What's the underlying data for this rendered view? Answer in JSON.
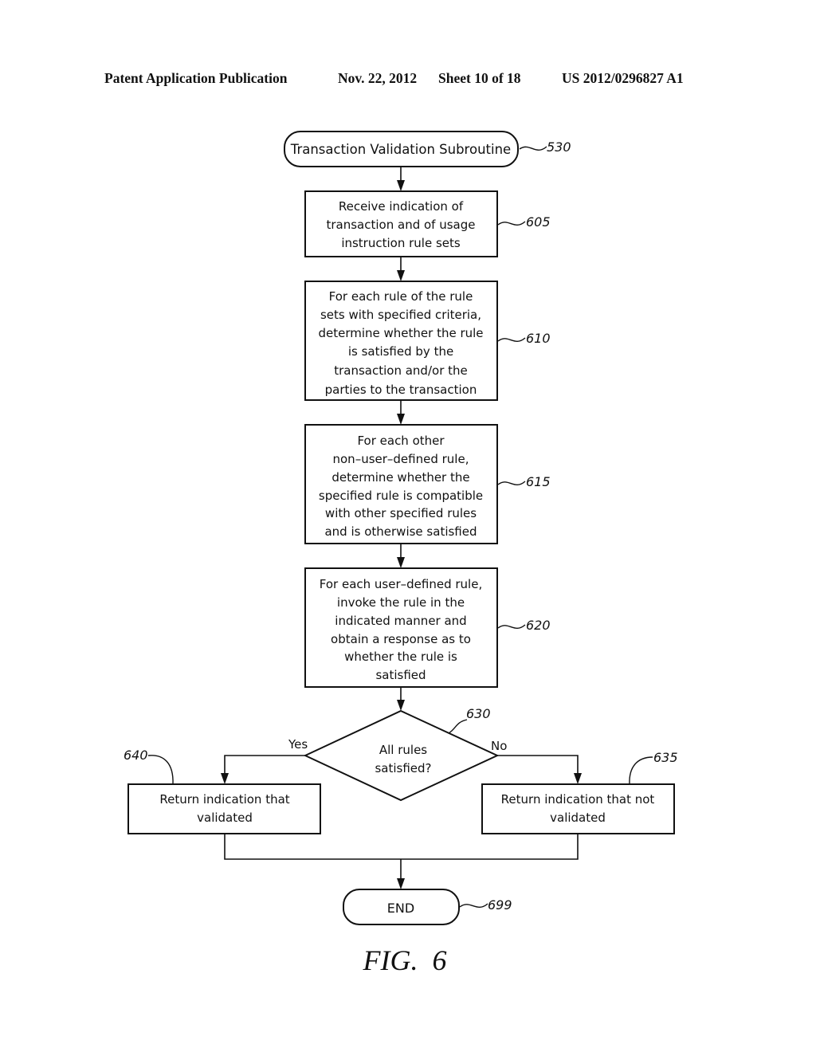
{
  "header": {
    "publication": "Patent Application Publication",
    "date": "Nov. 22, 2012",
    "sheet": "Sheet 10 of 18",
    "number": "US 2012/0296827 A1"
  },
  "diagram": {
    "start": {
      "label": "Transaction Validation Subroutine",
      "ref": "530"
    },
    "steps": [
      {
        "ref": "605",
        "lines": [
          "Receive indication of",
          "transaction and of usage",
          "instruction rule sets"
        ]
      },
      {
        "ref": "610",
        "lines": [
          "For each rule of the rule",
          "sets with specified criteria,",
          "determine whether the rule",
          "is satisfied by the",
          "transaction and/or the",
          "parties to the transaction"
        ]
      },
      {
        "ref": "615",
        "lines": [
          "For each other",
          "non–user–defined rule,",
          "determine whether the",
          "specified rule is compatible",
          "with other specified rules",
          "and is otherwise satisfied"
        ]
      },
      {
        "ref": "620",
        "lines": [
          "For each user–defined rule,",
          "invoke the rule in the",
          "indicated manner and",
          "obtain a response as to",
          "whether the rule is",
          "satisfied"
        ]
      }
    ],
    "decision": {
      "ref": "630",
      "lines": [
        "All rules",
        "satisfied?"
      ],
      "yes_label": "Yes",
      "no_label": "No"
    },
    "yes_result": {
      "ref": "640",
      "lines": [
        "Return indication that",
        "validated"
      ]
    },
    "no_result": {
      "ref": "635",
      "lines": [
        "Return indication that not",
        "validated"
      ]
    },
    "end": {
      "label": "END",
      "ref": "699"
    },
    "figure_label": "FIG.  6"
  }
}
